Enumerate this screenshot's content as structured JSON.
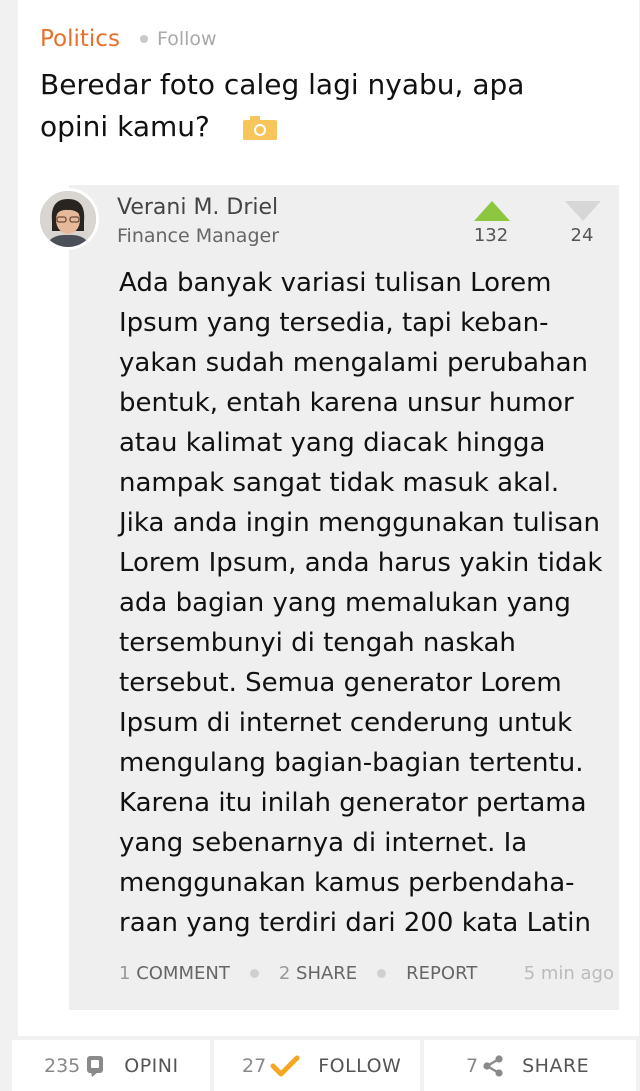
{
  "post": {
    "topic": "Politics",
    "follow_label": "Follow",
    "title": "Beredar foto caleg lagi nyabu, apa opini kamu?",
    "title_icon": "camera-icon"
  },
  "answer": {
    "author_name": "Verani M. Driel",
    "author_role": "Finance Manager",
    "upvotes": "132",
    "downvotes": "24",
    "body": "Ada banyak variasi tulisan Lorem Ipsum yang tersedia, tapi keban-yakan sudah mengalami perubahan bentuk, entah karena unsur humor atau kalimat yang diacak hingga nampak sangat tidak masuk akal. Jika anda ingin menggunakan tulisan Lorem Ipsum, anda harus yakin tidak ada bagian yang memalukan yang tersembunyi di tengah naskah tersebut. Semua generator Lorem Ipsum di internet cenderung untuk mengulang bagian-bagian tertentu. Karena itu inilah generator pertama yang sebenarnya di internet. Ia menggunakan kamus perbendaha-raan yang terdiri dari 200 kata Latin",
    "comment_count": "1",
    "comment_label": "COMMENT",
    "share_count": "2",
    "share_label": "SHARE",
    "report_label": "REPORT",
    "time": "5 min ago"
  },
  "bottom_bar": {
    "opini_count": "235",
    "opini_label": "OPINI",
    "follow_count": "27",
    "follow_label": "FOLLOW",
    "share_count": "7",
    "share_label": "SHARE"
  },
  "colors": {
    "accent_orange": "#e8702a",
    "upvote_green": "#8dc63f",
    "camera_yellow": "#f7c55a",
    "check_orange": "#f5a623",
    "answer_bg": "#eeefee"
  }
}
